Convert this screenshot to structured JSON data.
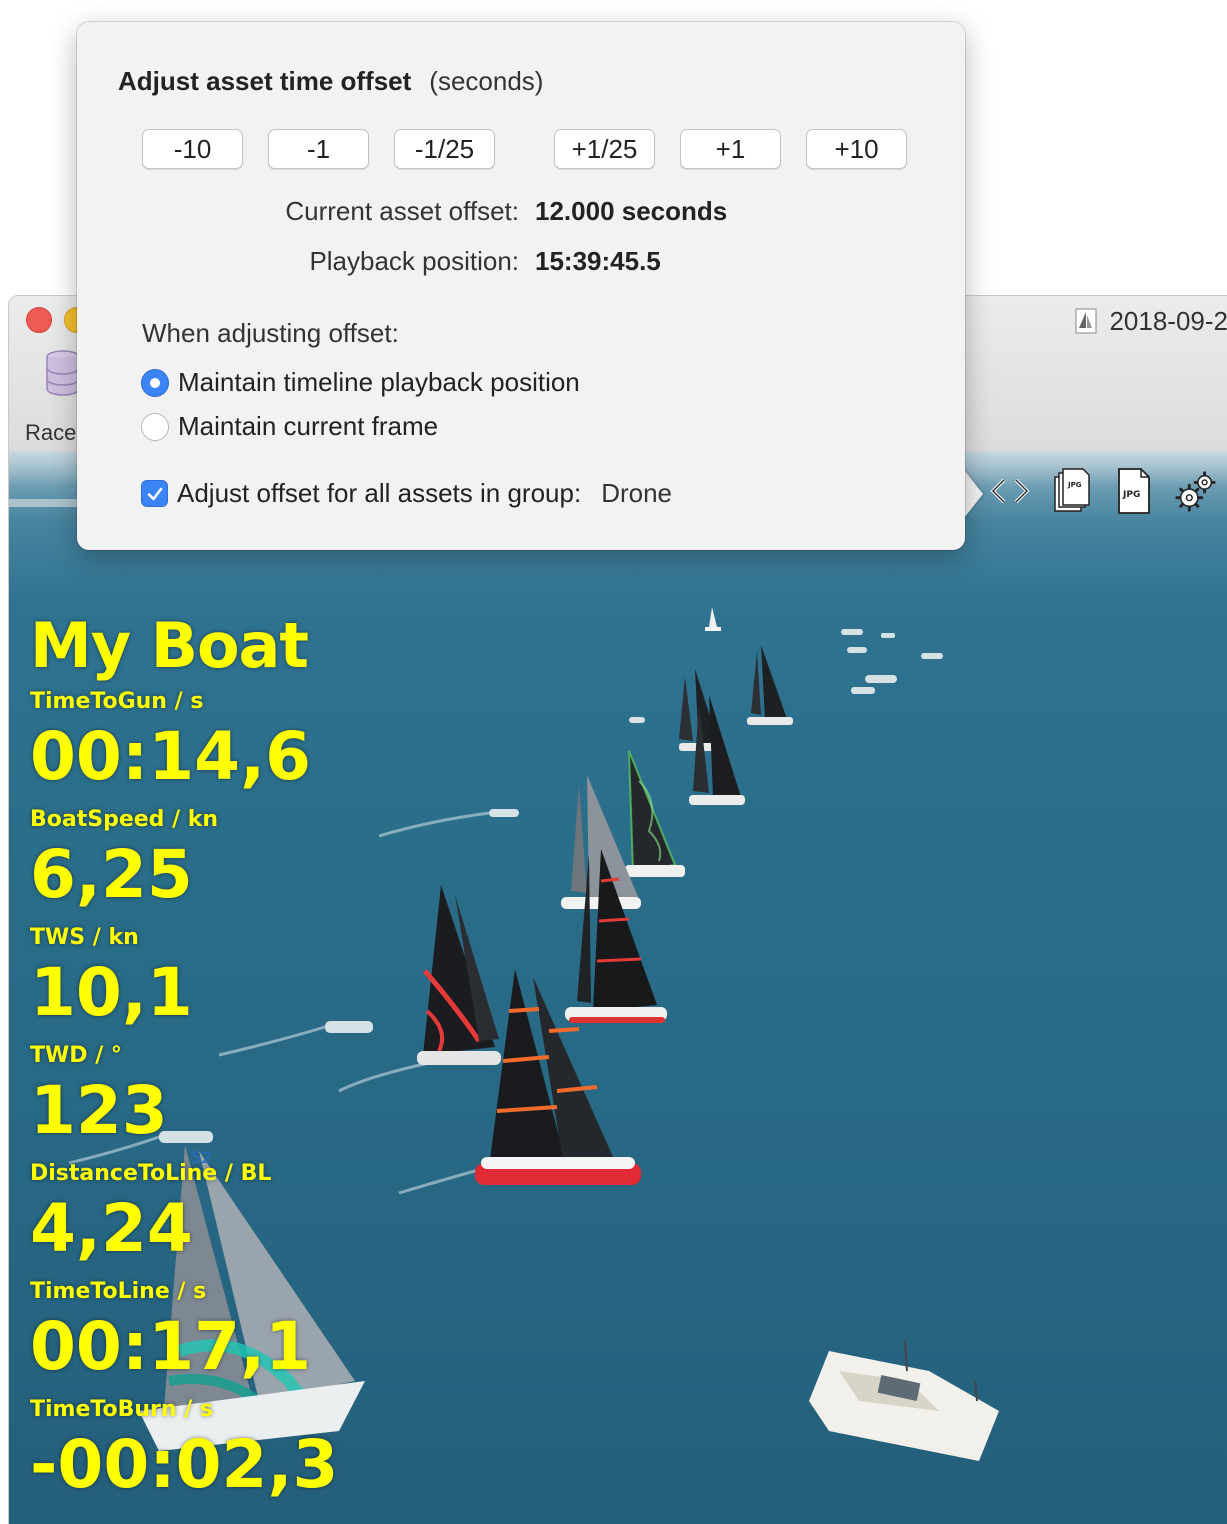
{
  "window": {
    "document_title": "2018-09-2",
    "toolbar_item_label": "Race"
  },
  "popover": {
    "title": "Adjust asset time offset",
    "title_unit": "(seconds)",
    "buttons": [
      "-10",
      "-1",
      "-1/25",
      "+1/25",
      "+1",
      "+10"
    ],
    "current_offset_label": "Current asset offset:",
    "current_offset_value": "12.000 seconds",
    "playback_label": "Playback position:",
    "playback_value": "15:39:45.5",
    "adjust_section_label": "When adjusting offset:",
    "radio_options": [
      {
        "label": "Maintain timeline playback position",
        "selected": true
      },
      {
        "label": "Maintain current frame",
        "selected": false
      }
    ],
    "group_checkbox": {
      "label": "Adjust offset for all assets in group:",
      "checked": true,
      "group_name": "Drone"
    }
  },
  "video_toolbar": {
    "icons": [
      "code-brackets-icon",
      "jpg-stack-icon",
      "jpg-file-icon",
      "gears-icon"
    ],
    "jpg_text": "JPG"
  },
  "overlay": {
    "boat_name": "My Boat",
    "metrics": [
      {
        "label": "TimeToGun / s",
        "value": "00:14,6"
      },
      {
        "label": "BoatSpeed / kn",
        "value": "6,25"
      },
      {
        "label": "TWS / kn",
        "value": "10,1"
      },
      {
        "label": "TWD / °",
        "value": "123"
      },
      {
        "label": "DistanceToLine / BL",
        "value": "4,24"
      },
      {
        "label": "TimeToLine / s",
        "value": "00:17,1"
      },
      {
        "label": "TimeToBurn / s",
        "value": "-00:02,3"
      }
    ],
    "text_color": "#ffff00"
  },
  "colors": {
    "accent_blue": "#3a84f6",
    "sea": "#2a6d89",
    "close_button": "#ee5b55",
    "minimize_button": "#f5bf2d"
  }
}
